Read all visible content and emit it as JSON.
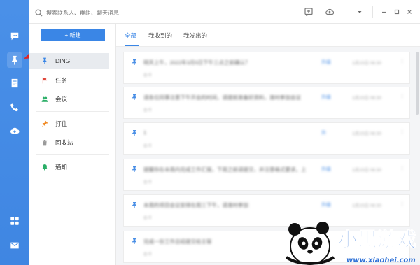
{
  "search": {
    "placeholder": "搜索联系人、群组、聊天消息"
  },
  "menu": {
    "new_button": "+ 新建",
    "items": [
      {
        "label": "DING"
      },
      {
        "label": "任务"
      },
      {
        "label": "会议"
      },
      {
        "label": "打住"
      },
      {
        "label": "回收站"
      },
      {
        "label": "通知"
      }
    ]
  },
  "tabs": [
    {
      "label": "全部"
    },
    {
      "label": "我收到的"
    },
    {
      "label": "我发出的"
    }
  ],
  "messages": [
    {
      "title": "明天上午，2022年3月5日下午三点之前确认？",
      "sub": "◎ 0",
      "tag": "升级",
      "time": "1月15日 08:30"
    },
    {
      "title": "请各位同事注意下午开会的时间，请提前准备好资料，准时参加会议",
      "sub": "◎ 0",
      "tag": "升级",
      "time": "1月15日 08:30"
    },
    {
      "title": "1",
      "sub": "◎ 0",
      "tag": "升",
      "time": "1月15日 08:30"
    },
    {
      "title": "提醒你在本周内完成工作汇报，下周之前请提交，并注意格式要求。上",
      "sub": "◎ 0",
      "tag": "升级",
      "time": "1月15日 08:30"
    },
    {
      "title": "本周的项目会议安排在周三下午，请准时参加",
      "sub": "◎ 0",
      "tag": "升级",
      "time": "1月15日 08:30"
    },
    {
      "title": "完成一份工作总结提交给主管",
      "sub": "◎ 0",
      "tag": "",
      "time": ""
    }
  ],
  "watermark": {
    "text": "小黑游戏",
    "url": "www.xiaohei.com"
  },
  "colors": {
    "accent": "#3a86e6",
    "rail": "#4a90e8",
    "pointer": "#e02424"
  }
}
